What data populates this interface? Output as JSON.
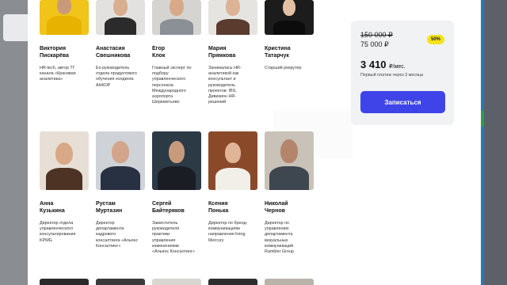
{
  "speakers_row1": [
    {
      "name1": "Виктория",
      "name2": "Пискарёва",
      "desc": [
        "HR-tech, автор ТГ",
        "канала «Красивая",
        "аналитика»"
      ]
    },
    {
      "name1": "Анастасия",
      "name2": "Свешникова",
      "desc": [
        "Ex-руководитель",
        "отдела продуктового",
        "обучения холдинга",
        "АНКОР"
      ]
    },
    {
      "name1": "Егор",
      "name2": "Клок",
      "desc": [
        "Главный эксперт по",
        "подбору",
        "управленческого",
        "персонала",
        "Международного",
        "аэропорта",
        "Шереметьево"
      ]
    },
    {
      "name1": "Мария",
      "name2": "Прямкова",
      "desc": [
        "Занималась HR-",
        "аналитикой как",
        "консультант и",
        "руководитель",
        "проектов: IBS,",
        "Дивизион HR-",
        "решений"
      ]
    },
    {
      "name1": "Кристина",
      "name2": "Татарчук",
      "desc": [
        "Старший рекрутер"
      ]
    }
  ],
  "speakers_row2": [
    {
      "name1": "Анна",
      "name2": "Кузькина",
      "desc": [
        "Директор отдела",
        "управленческого",
        "консультирования",
        "KPMG"
      ]
    },
    {
      "name1": "Рустам",
      "name2": "Муртазин",
      "desc": [
        "Директор",
        "департамента",
        "кадрового",
        "консалтинга «Альянс",
        "Консалтинг»"
      ]
    },
    {
      "name1": "Сергей",
      "name2": "Байтеряков",
      "desc": [
        "Заместитель",
        "руководителя",
        "практики",
        "управления",
        "изменениями",
        "«Альянс Консалтинг»"
      ]
    },
    {
      "name1": "Ксения",
      "name2": "Понька",
      "desc": [
        "Директор по бренд-",
        "коммуникациям",
        "направления living",
        "Mercury"
      ]
    },
    {
      "name1": "Николай",
      "name2": "Чернов",
      "desc": [
        "Директор по",
        "управлению",
        "департамента",
        "визуальных",
        "коммуникаций",
        "Rambler Group"
      ]
    }
  ],
  "pricing": {
    "old_price": "150 000 ₽",
    "price": "75 000 ₽",
    "discount_badge": "50%",
    "monthly_amount": "3 410",
    "monthly_unit": "₽/мес.",
    "note": "Первый платеж через 3 месяца",
    "cta_label": "Записаться"
  },
  "colors": {
    "accent": "#3f44e8",
    "badge": "#f5e21b"
  }
}
